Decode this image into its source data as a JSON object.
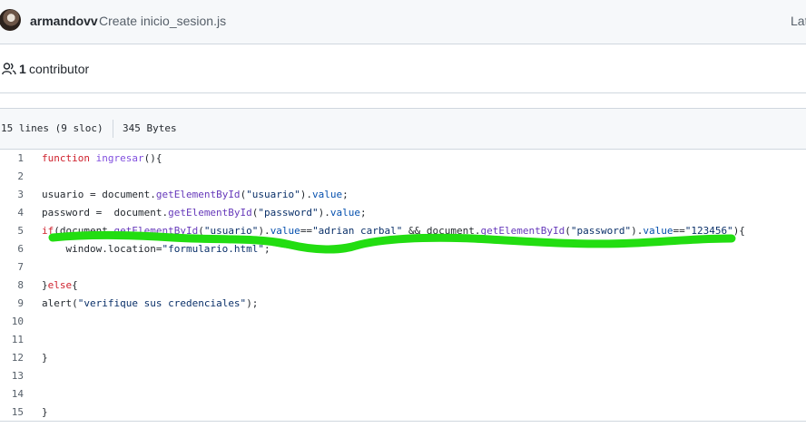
{
  "commit": {
    "author": "armandovv",
    "message": "Create inicio_sesion.js",
    "latest_label": "Lat"
  },
  "contributors": {
    "icon": "people-icon",
    "count": "1",
    "label": "contributor"
  },
  "file_info": {
    "lines": "15 lines (9 sloc)",
    "size": "345 Bytes"
  },
  "code": {
    "lines": [
      {
        "n": "1",
        "text": "function ingresar(){"
      },
      {
        "n": "2",
        "text": ""
      },
      {
        "n": "3",
        "text": "usuario = document.getElementById(\"usuario\").value;"
      },
      {
        "n": "4",
        "text": "password =  document.getElementById(\"password\").value;"
      },
      {
        "n": "5",
        "text": "if(document.getElementById(\"usuario\").value==\"adrian carbal\" && document.getElementById(\"password\").value==\"123456\"){"
      },
      {
        "n": "6",
        "text": "    window.location=\"formulario.html\";"
      },
      {
        "n": "7",
        "text": ""
      },
      {
        "n": "8",
        "text": "}else{"
      },
      {
        "n": "9",
        "text": "alert(\"verifique sus credenciales\");"
      },
      {
        "n": "10",
        "text": ""
      },
      {
        "n": "11",
        "text": ""
      },
      {
        "n": "12",
        "text": "}"
      },
      {
        "n": "13",
        "text": ""
      },
      {
        "n": "14",
        "text": ""
      },
      {
        "n": "15",
        "text": "}"
      }
    ]
  },
  "colors": {
    "keyword": "#cf222e",
    "function": "#8250df",
    "string": "#0a3069",
    "property": "#0550ae",
    "scribble": "#22dd11"
  }
}
